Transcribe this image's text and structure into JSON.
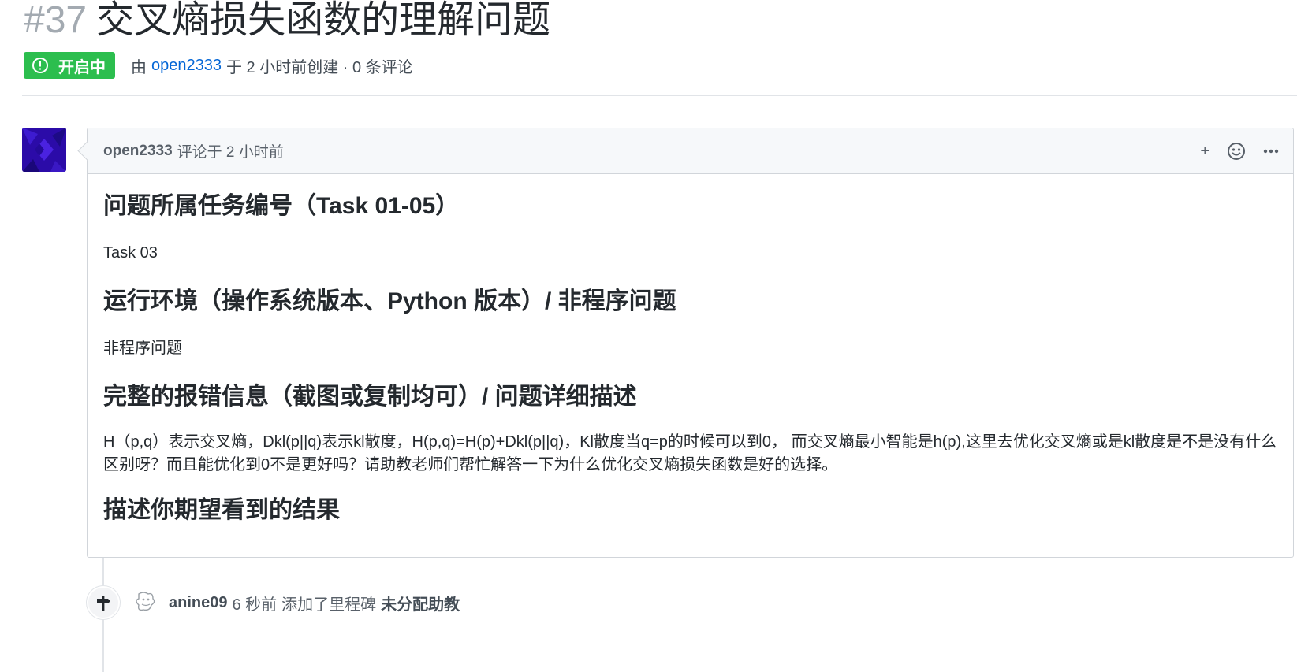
{
  "issue": {
    "number": "#37",
    "title": "交叉熵损失函数的理解问题",
    "state_label": "开启中",
    "meta_by": "由",
    "author": "open2333",
    "meta_rest": "于 2 小时前创建 · 0 条评论"
  },
  "comment": {
    "author": "open2333",
    "time_text": "评论于 2 小时前",
    "actions": {
      "add": "+",
      "reaction_icon": "smiley-icon",
      "more_icon": "kebab-horizontal-icon"
    },
    "sections": [
      {
        "heading": "问题所属任务编号（Task 01-05）",
        "body": "Task 03"
      },
      {
        "heading": "运行环境（操作系统版本、Python 版本）/ 非程序问题",
        "body": "非程序问题"
      },
      {
        "heading": "完整的报错信息（截图或复制均可）/ 问题详细描述",
        "body": "H（p,q）表示交叉熵，Dkl(p||q)表示kl散度，H(p,q)=H(p)+Dkl(p||q)，Kl散度当q=p的时候可以到0， 而交叉熵最小智能是h(p),这里去优化交叉熵或是kl散度是不是没有什么区别呀？而且能优化到0不是更好吗？请助教老师们帮忙解答一下为什么优化交叉熵损失函数是好的选择。"
      },
      {
        "heading": "描述你期望看到的结果",
        "body": ""
      }
    ]
  },
  "timeline": {
    "event": {
      "icon": "milestone-icon",
      "actor": "anine09",
      "time": "6 秒前",
      "action": "添加了里程碑",
      "milestone": "未分配助教"
    }
  },
  "colors": {
    "open_green": "#2cbe4e",
    "link_blue": "#0366d6",
    "muted_gray": "#586069",
    "border": "#d1d5da"
  }
}
